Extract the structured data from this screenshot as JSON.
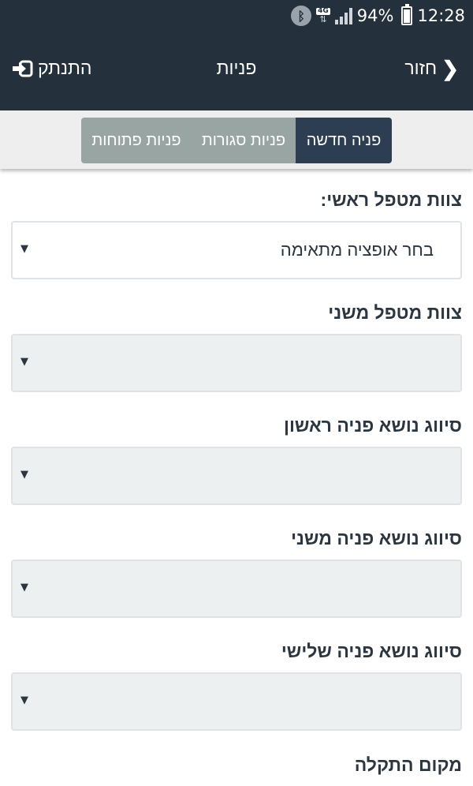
{
  "status": {
    "battery": "94%",
    "time": "12:28",
    "network": "4G",
    "icons": [
      "bluetooth-icon",
      "network-4g-icon",
      "signal-icon",
      "battery-icon"
    ]
  },
  "header": {
    "title": "פניות",
    "back_label": "חזור",
    "logout_label": "התנתק",
    "background": "#24303b"
  },
  "tabs": [
    {
      "label": "פניה חדשה",
      "active": true
    },
    {
      "label": "פניות סגורות",
      "active": false
    },
    {
      "label": "פניות פתוחות",
      "active": false
    }
  ],
  "form": {
    "fields": [
      {
        "label": "צוות מטפל ראשי:",
        "value": "בחר אופציה מתאימה"
      },
      {
        "label": "צוות מטפל משני",
        "value": ""
      },
      {
        "label": "סיווג נושא פניה ראשון",
        "value": ""
      },
      {
        "label": "סיווג נושא פניה משני",
        "value": ""
      },
      {
        "label": "סיווג נושא פניה שלישי",
        "value": ""
      }
    ],
    "last_label": "מקום התקלה"
  },
  "colors": {
    "tab_active": "#2d3e53",
    "tab_inactive": "#98a5a2",
    "field_empty_bg": "#edf0f1"
  }
}
